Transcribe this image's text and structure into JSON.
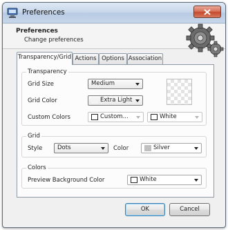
{
  "window": {
    "title": "Preferences",
    "close_glyph": "✕"
  },
  "header": {
    "title": "Preferences",
    "subtitle": "Change preferences"
  },
  "tabs": [
    {
      "label": "Transparency/Grid",
      "active": true
    },
    {
      "label": "Actions",
      "active": false
    },
    {
      "label": "Options",
      "active": false
    },
    {
      "label": "Association",
      "active": false
    }
  ],
  "transparency": {
    "group_title": "Transparency",
    "grid_size_label": "Grid Size",
    "grid_size_value": "Medium",
    "grid_color_label": "Grid Color",
    "grid_color_value": "Extra Light",
    "custom_colors_label": "Custom Colors",
    "custom_color_1": "Custom...",
    "custom_color_2": "White"
  },
  "grid": {
    "group_title": "Grid",
    "style_label": "Style",
    "style_value": "Dots",
    "color_label": "Color",
    "color_value": "Silver"
  },
  "colors": {
    "group_title": "Colors",
    "preview_bg_label": "Preview Background Color",
    "preview_bg_value": "White"
  },
  "buttons": {
    "ok": "OK",
    "cancel": "Cancel"
  },
  "palette": {
    "silver": "#c0c0c0",
    "white": "#ffffff",
    "extra_light": "#f4f4f4",
    "accent_blue": "#3c7fb1"
  },
  "icons": [
    "preferences-app-icon",
    "close-icon",
    "gears-icon",
    "chevron-down-icon"
  ]
}
